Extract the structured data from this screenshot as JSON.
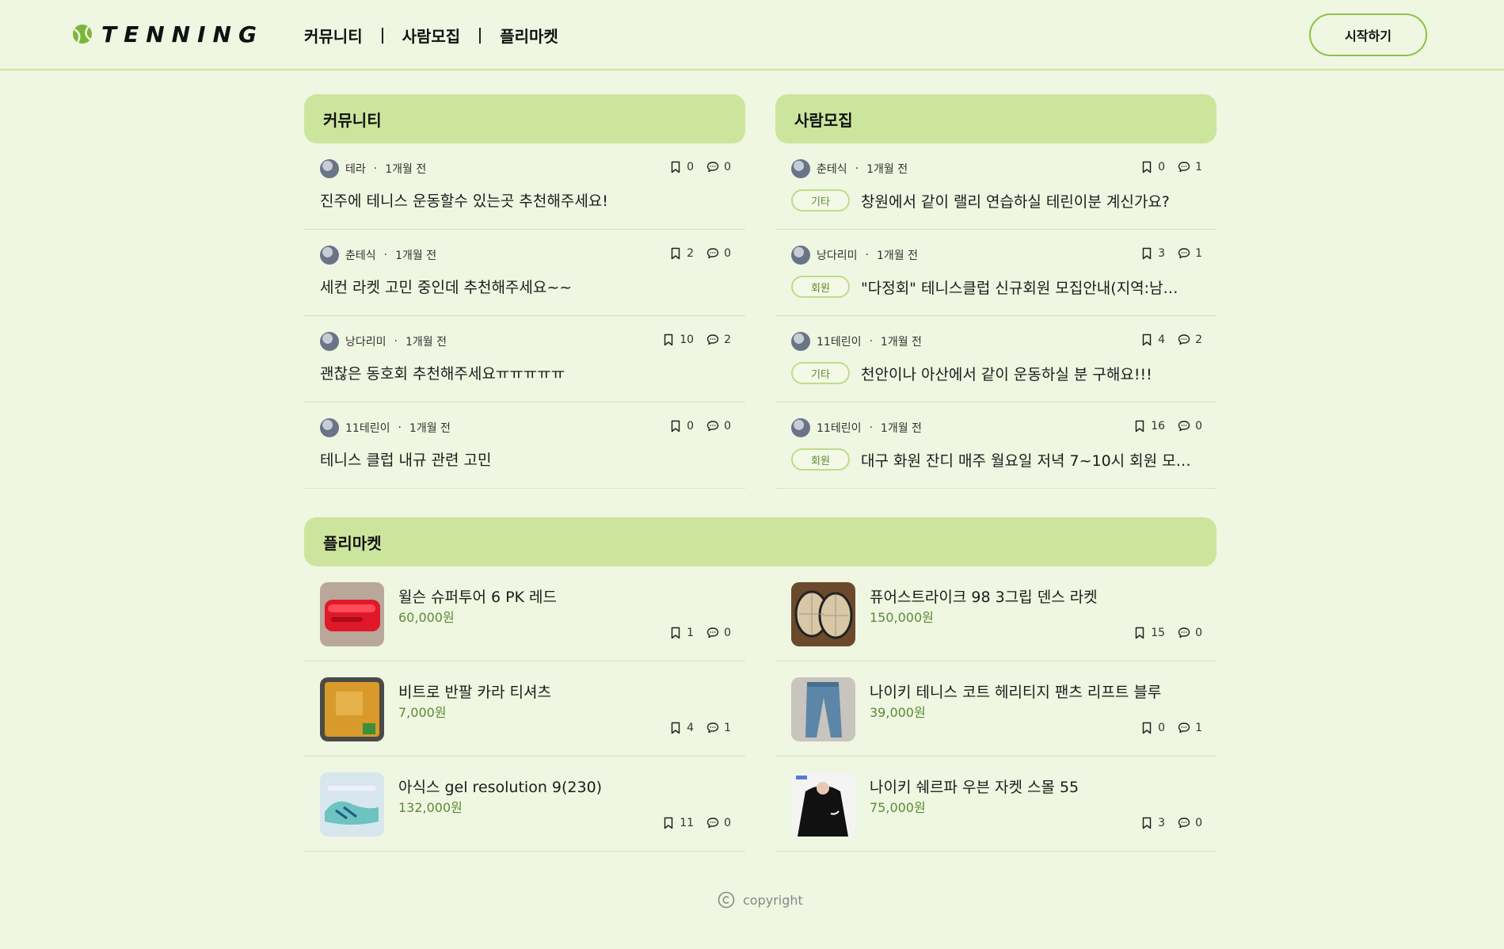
{
  "brand": {
    "logo_text": "TENNING"
  },
  "nav": {
    "items": [
      "커뮤니티",
      "사람모집",
      "플리마켓"
    ],
    "start_label": "시작하기"
  },
  "community": {
    "title": "커뮤니티",
    "posts": [
      {
        "author": "테라",
        "time": "1개월 전",
        "bookmarks": "0",
        "comments": "0",
        "title": "진주에 테니스 운동할수 있는곳 추천해주세요!"
      },
      {
        "author": "춘테식",
        "time": "1개월 전",
        "bookmarks": "2",
        "comments": "0",
        "title": "세컨 라켓 고민 중인데 추천해주세요~~"
      },
      {
        "author": "낭다리미",
        "time": "1개월 전",
        "bookmarks": "10",
        "comments": "2",
        "title": "괜찮은 동호회 추천해주세요ㅠㅠㅠㅠㅠ"
      },
      {
        "author": "11테린이",
        "time": "1개월 전",
        "bookmarks": "0",
        "comments": "0",
        "title": "테니스 클럽 내규 관련 고민"
      }
    ]
  },
  "recruit": {
    "title": "사람모집",
    "posts": [
      {
        "author": "춘테식",
        "time": "1개월 전",
        "bookmarks": "0",
        "comments": "1",
        "badge": "기타",
        "title": "창원에서 같이 랠리 연습하실 테린이분 계신가요?"
      },
      {
        "author": "낭다리미",
        "time": "1개월 전",
        "bookmarks": "3",
        "comments": "1",
        "badge": "회원",
        "title": "\"다정회\" 테니스클럽 신규회원 모집안내(지역:남…"
      },
      {
        "author": "11테린이",
        "time": "1개월 전",
        "bookmarks": "4",
        "comments": "2",
        "badge": "기타",
        "title": "천안이나 아산에서 같이 운동하실 분 구해요!!!"
      },
      {
        "author": "11테린이",
        "time": "1개월 전",
        "bookmarks": "16",
        "comments": "0",
        "badge": "회원",
        "title": "대구 화원 잔디 매주 월요일 저녁 7~10시 회원 모…"
      }
    ]
  },
  "flea": {
    "title": "플리마켓",
    "items": [
      {
        "title": "윌슨 슈퍼투어 6 PK 레드",
        "price": "60,000원",
        "bookmarks": "1",
        "comments": "0",
        "thumb": "red-bag"
      },
      {
        "title": "퓨어스트라이크 98 3그립 덴스 라켓",
        "price": "150,000원",
        "bookmarks": "15",
        "comments": "0",
        "thumb": "rackets"
      },
      {
        "title": "비트로 반팔 카라 티셔츠",
        "price": "7,000원",
        "bookmarks": "4",
        "comments": "1",
        "thumb": "yellow-shirt"
      },
      {
        "title": "나이키 테니스 코트 헤리티지 팬츠 리프트 블루",
        "price": "39,000원",
        "bookmarks": "0",
        "comments": "1",
        "thumb": "blue-pants"
      },
      {
        "title": "아식스 gel resolution 9(230)",
        "price": "132,000원",
        "bookmarks": "11",
        "comments": "0",
        "thumb": "shoes"
      },
      {
        "title": "나이키 쉐르파 우븐 자켓 스몰 55",
        "price": "75,000원",
        "bookmarks": "3",
        "comments": "0",
        "thumb": "black-jacket"
      }
    ]
  },
  "footer": {
    "copyright": "copyright"
  },
  "colors": {
    "background": "#eff6e1",
    "accent": "#cce59d",
    "accent_border": "#8bc34a",
    "price": "#5c8a35"
  }
}
